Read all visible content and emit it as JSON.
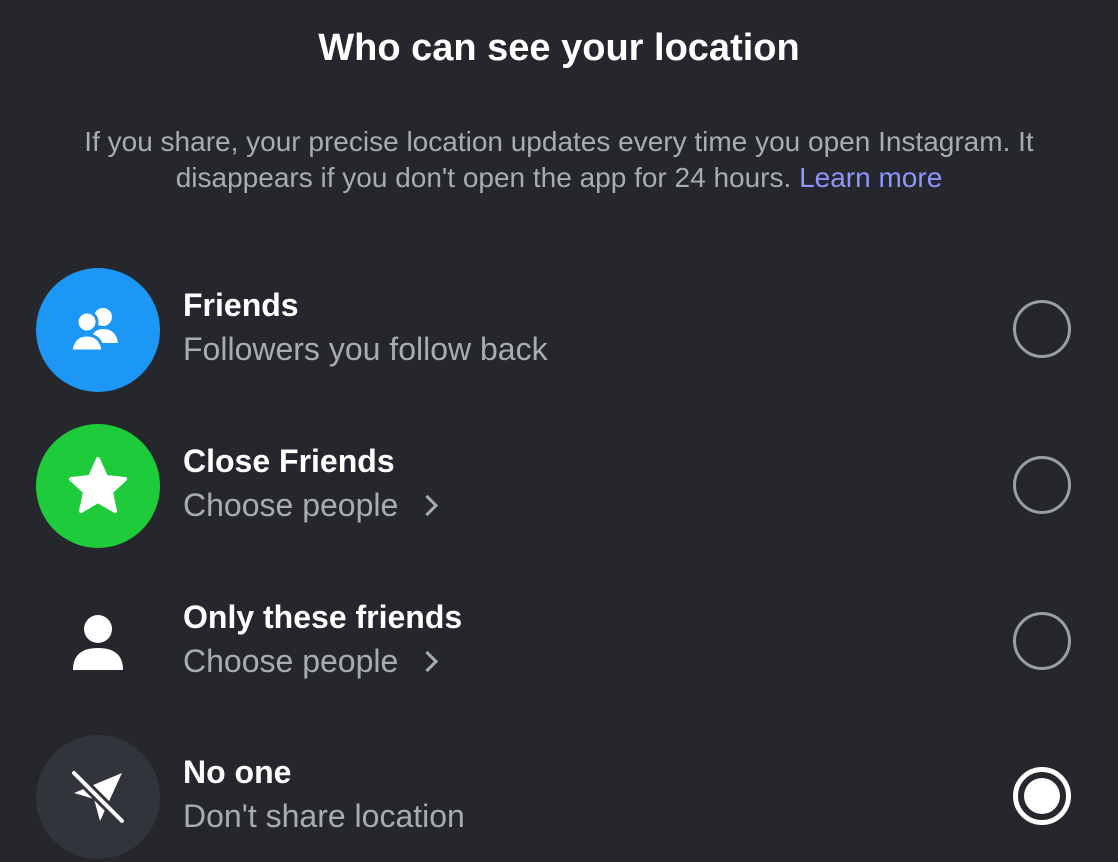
{
  "header": {
    "title": "Who can see your location"
  },
  "description": {
    "text": "If you share, your precise location updates every time you open Instagram. It disappears if you don't open the app for 24 hours.",
    "link": "Learn more"
  },
  "options": [
    {
      "title": "Friends",
      "subtitle": "Followers you follow back",
      "icon": "friends-icon",
      "icon_bg": "#1c97f5",
      "selected": false
    },
    {
      "title": "Close Friends",
      "subtitle": "Choose people",
      "icon": "star-icon",
      "icon_bg": "#1ecb3a",
      "selected": false
    },
    {
      "title": "Only these friends",
      "subtitle": "Choose people",
      "icon": "person-icon",
      "icon_bg": "#25272c",
      "selected": false
    },
    {
      "title": "No one",
      "subtitle": "Don't share location",
      "icon": "location-off-icon",
      "icon_bg": "#31343a",
      "selected": true
    }
  ],
  "colors": {
    "background": "#25272c",
    "link": "#8f95ff",
    "secondary_text": "#a8acb3"
  }
}
